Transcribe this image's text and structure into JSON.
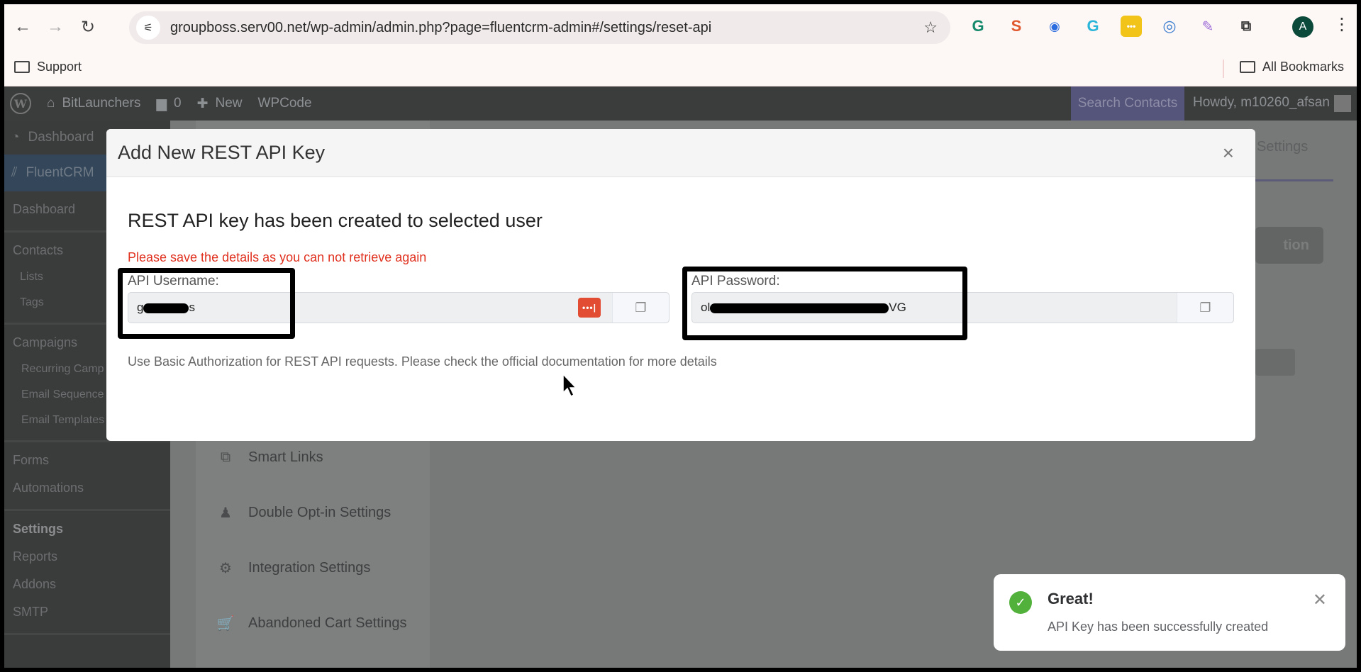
{
  "browser": {
    "url": "groupboss.serv00.net/wp-admin/admin.php?page=fluentcrm-admin#/settings/reset-api",
    "bookmarks": [
      {
        "label": "Support"
      }
    ],
    "all_bookmarks_label": "All Bookmarks",
    "profile_initial": "A",
    "extensions": [
      {
        "name": "grammarly",
        "glyph": "G",
        "color": "#15896b"
      },
      {
        "name": "seo",
        "glyph": "S",
        "color": "#e0582e"
      },
      {
        "name": "screen-recorder",
        "glyph": "◉",
        "color": "#2a6be0"
      },
      {
        "name": "g-extension",
        "glyph": "G",
        "color": "#2bb5d8"
      },
      {
        "name": "lastpass",
        "glyph": "•••",
        "color": "#f2c318"
      },
      {
        "name": "compass",
        "glyph": "◎",
        "color": "#3c7fd0"
      },
      {
        "name": "quill",
        "glyph": "✎",
        "color": "#9b6ad8"
      },
      {
        "name": "extensions",
        "glyph": "⧉",
        "color": "#333333"
      }
    ]
  },
  "wp_admin_bar": {
    "site_name": "BitLaunchers",
    "comments_count": "0",
    "new_label": "New",
    "wpcode_label": "WPCode",
    "search_contacts_label": "Search Contacts",
    "howdy": "Howdy, m10260_afsan"
  },
  "sidebar": {
    "dashboard": "Dashboard",
    "fluentcrm": "FluentCRM",
    "sections": [
      {
        "items": [
          {
            "label": "Dashboard",
            "level": 0
          }
        ]
      },
      {
        "items": [
          {
            "label": "Contacts",
            "level": 0
          },
          {
            "label": "Lists",
            "level": 1
          },
          {
            "label": "Tags",
            "level": 1
          }
        ]
      },
      {
        "items": [
          {
            "label": "Campaigns",
            "level": 0
          },
          {
            "label": "Recurring Camp",
            "level": 2
          },
          {
            "label": "Email Sequence",
            "level": 2
          },
          {
            "label": "Email Templates",
            "level": 2
          }
        ]
      },
      {
        "items": [
          {
            "label": "Forms",
            "level": 0
          },
          {
            "label": "Automations",
            "level": 0
          }
        ]
      },
      {
        "items": [
          {
            "label": "Settings",
            "level": 0,
            "active": true
          },
          {
            "label": "Reports",
            "level": 0
          },
          {
            "label": "Addons",
            "level": 0
          },
          {
            "label": "SMTP",
            "level": 0
          }
        ]
      }
    ]
  },
  "background": {
    "tab_label": "Settings",
    "button_fragment": "tion",
    "settings_menu": [
      {
        "label": "Smart Links",
        "icon": "link-icon"
      },
      {
        "label": "Double Opt-in Settings",
        "icon": "user-stamp-icon"
      },
      {
        "label": "Integration Settings",
        "icon": "gear-icon"
      },
      {
        "label": "Abandoned Cart Settings",
        "icon": "cart-icon"
      }
    ]
  },
  "modal": {
    "title": "Add New REST API Key",
    "heading": "REST API key has been created to selected user",
    "warning": "Please save the details as you can not retrieve again",
    "username_label": "API Username:",
    "username_prefix": "g",
    "username_suffix": "s",
    "password_label": "API Password:",
    "password_prefix": "ol",
    "password_suffix": "VG",
    "help_text": "Use Basic Authorization for REST API requests. Please check the official documentation for more details",
    "close_glyph": "×",
    "warning_color": "#e0311f"
  },
  "toast": {
    "title": "Great!",
    "message": "API Key has been successfully created",
    "status_color": "#52b13b"
  }
}
